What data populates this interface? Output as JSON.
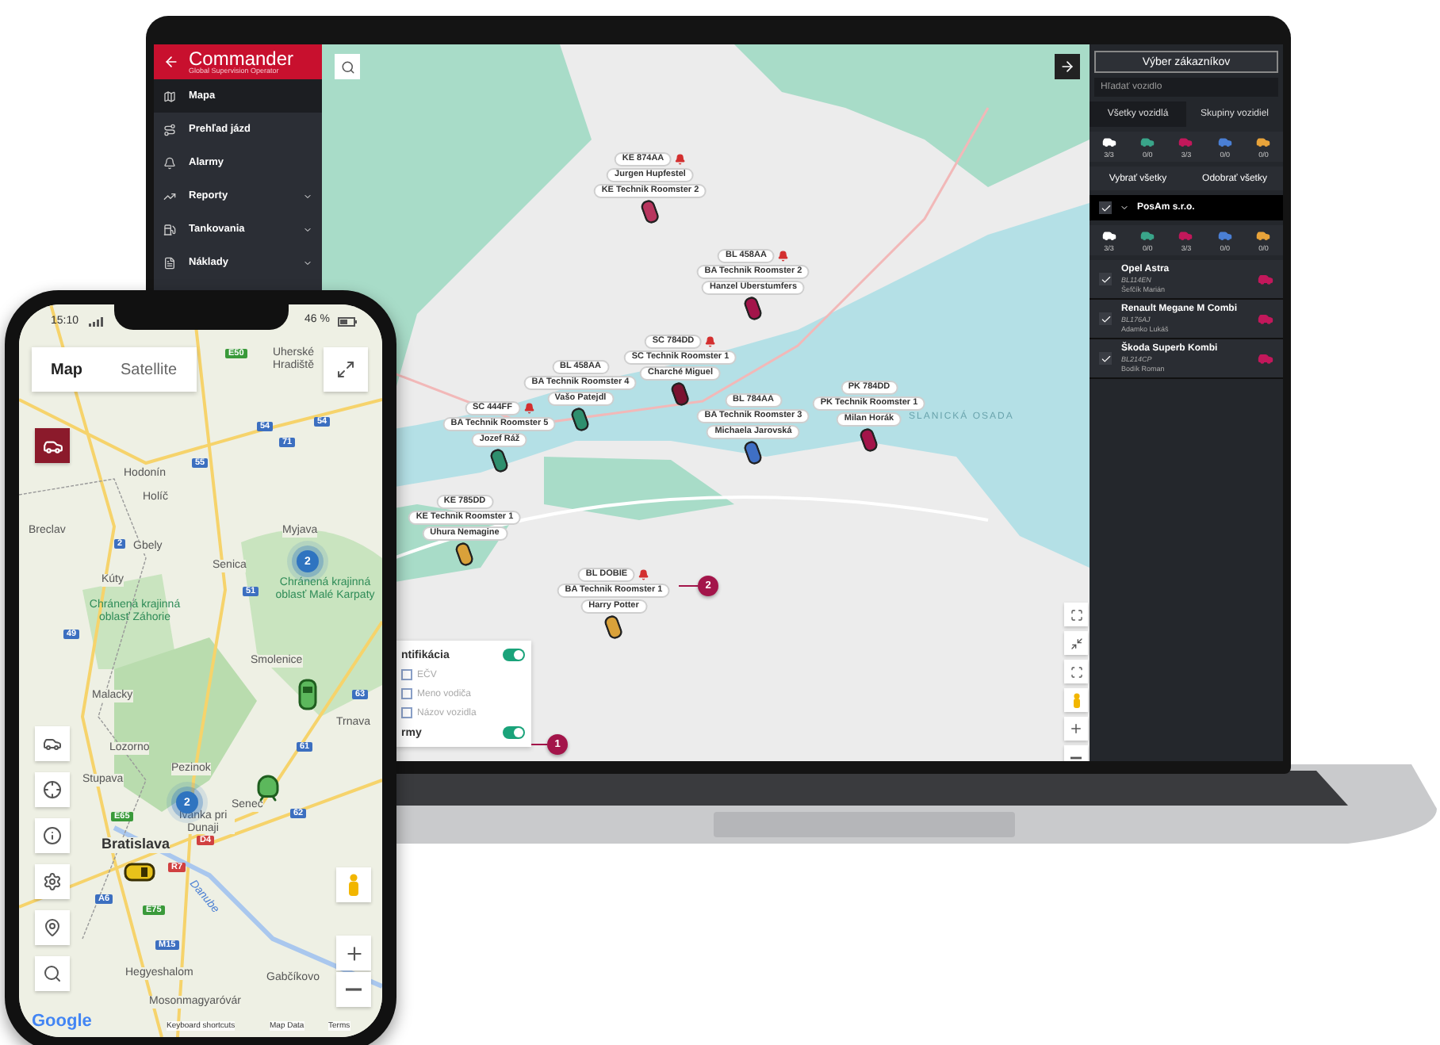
{
  "laptop": {
    "sidebar": {
      "logo": "Commander",
      "tagline": "Global Supervision Operator",
      "items": [
        {
          "label": "Mapa",
          "selected": true,
          "expandable": false
        },
        {
          "label": "Prehľad jázd",
          "selected": false,
          "expandable": false
        },
        {
          "label": "Alarmy",
          "selected": false,
          "expandable": false
        },
        {
          "label": "Reporty",
          "selected": false,
          "expandable": true
        },
        {
          "label": "Tankovania",
          "selected": false,
          "expandable": true
        },
        {
          "label": "Náklady",
          "selected": false,
          "expandable": true
        }
      ]
    },
    "map": {
      "markers": [
        {
          "plate": "KE 874AA",
          "driver": "Jurgen Hupfestel",
          "vehicle": "KE Technik Roomster 2",
          "alarm": true,
          "color": "#b8355e"
        },
        {
          "plate": "BL 458AA",
          "driver": "BA Technik Roomster 2",
          "vehicle": "Hanzel Uberstumfers",
          "alarm": true,
          "color": "#a3154a"
        },
        {
          "plate": "SC 784DD",
          "driver": "SC Technik Roomster 1",
          "vehicle": "Charché Miguel",
          "alarm": true,
          "color": "#7a1230"
        },
        {
          "plate": "BL 458AA",
          "driver": "BA Technik Roomster 4",
          "vehicle": "Vašo Patejdl",
          "alarm": false,
          "color": "#2f8f6e"
        },
        {
          "plate": "SC 444FF",
          "driver": "BA Technik Roomster 5",
          "vehicle": "Jozef Ráž",
          "alarm": true,
          "color": "#2f8f6e"
        },
        {
          "plate": "BL 784AA",
          "driver": "BA Technik Roomster 3",
          "vehicle": "Michaela Jarovská",
          "alarm": false,
          "color": "#3f6fc4"
        },
        {
          "plate": "PK 784DD",
          "driver": "PK Technik Roomster 1",
          "vehicle": "Milan Horák",
          "alarm": false,
          "color": "#a3154a"
        },
        {
          "plate": "KE 785DD",
          "driver": "KE Technik Roomster 1",
          "vehicle": "Uhura Nemagine",
          "alarm": false,
          "color": "#d9a13a"
        },
        {
          "plate": "BL DOBIE",
          "driver": "BA Technik Roomster 1",
          "vehicle": "Harry Potter",
          "alarm": true,
          "color": "#d9a13a"
        }
      ],
      "marker_callout": "2",
      "place_label": "SLANICKÁ OSADA",
      "legend": {
        "title": "ntifikácia",
        "on": true,
        "options": [
          {
            "label": "EČV",
            "checked": false
          },
          {
            "label": "Meno vodiča",
            "checked": false
          },
          {
            "label": "Názov vozidla",
            "checked": false
          }
        ],
        "alarms": {
          "label": "rmy",
          "on": true,
          "callout": "1"
        }
      }
    },
    "panel": {
      "customer_button": "Výber zákazníkov",
      "search": {
        "placeholder": "Hľadať vozidlo"
      },
      "tabs": [
        {
          "label": "Všetky vozidlá",
          "selected": true
        },
        {
          "label": "Skupiny vozidiel",
          "selected": false
        }
      ],
      "counts": [
        {
          "color": "#ffffff",
          "count": "3/3"
        },
        {
          "color": "#3aa58a",
          "count": "0/0"
        },
        {
          "color": "#c2185b",
          "count": "3/3"
        },
        {
          "color": "#4a7fd4",
          "count": "0/0"
        },
        {
          "color": "#e8a33a",
          "count": "0/0"
        }
      ],
      "select_all": "Vybrať všetky",
      "deselect_all": "Odobrať všetky",
      "group": {
        "name": "PosAm s.r.o.",
        "checked": true,
        "expanded": true,
        "counts": [
          {
            "color": "#ffffff",
            "count": "3/3"
          },
          {
            "color": "#3aa58a",
            "count": "0/0"
          },
          {
            "color": "#c2185b",
            "count": "3/3"
          },
          {
            "color": "#4a7fd4",
            "count": "0/0"
          },
          {
            "color": "#e8a33a",
            "count": "0/0"
          }
        ]
      },
      "vehicles": [
        {
          "name": "Opel Astra",
          "plate": "BL114EN",
          "driver": "Šefčík Marián",
          "checked": true,
          "color": "#c2185b"
        },
        {
          "name": "Renault Megane M Combi",
          "plate": "BL176AJ",
          "driver": "Adamko Lukáš",
          "checked": true,
          "color": "#c2185b"
        },
        {
          "name": "Škoda Superb Kombi",
          "plate": "BL214CP",
          "driver": "Bodík Roman",
          "checked": true,
          "color": "#c2185b"
        }
      ]
    }
  },
  "phone": {
    "time": "15:10",
    "battery": "46 %",
    "tabs": [
      {
        "label": "Map",
        "selected": true
      },
      {
        "label": "Satellite",
        "selected": false
      }
    ],
    "vehicle_filter": {
      "selected": true
    },
    "places": [
      {
        "text": "E50",
        "kind": "euroroute"
      },
      {
        "text": "Uherské Hradiště",
        "kind": "town"
      },
      {
        "text": "54",
        "kind": "motorway"
      },
      {
        "text": "54",
        "kind": "motorway"
      },
      {
        "text": "71",
        "kind": "motorway"
      },
      {
        "text": "55",
        "kind": "motorway"
      },
      {
        "text": "Hodonín",
        "kind": "town"
      },
      {
        "text": "Holíč",
        "kind": "town"
      },
      {
        "text": "Breclav",
        "kind": "town"
      },
      {
        "text": "2",
        "kind": "motorway"
      },
      {
        "text": "Gbely",
        "kind": "town"
      },
      {
        "text": "Kúty",
        "kind": "town"
      },
      {
        "text": "Senica",
        "kind": "town"
      },
      {
        "text": "51",
        "kind": "motorway"
      },
      {
        "text": "Myjava",
        "kind": "town"
      },
      {
        "text": "Chránená krajinná oblasť Malé Karpaty",
        "kind": "park"
      },
      {
        "text": "Chránená krajinná oblasť Záhorie",
        "kind": "park"
      },
      {
        "text": "49",
        "kind": "motorway"
      },
      {
        "text": "Smolenice",
        "kind": "town"
      },
      {
        "text": "Malacky",
        "kind": "town"
      },
      {
        "text": "Lozorno",
        "kind": "town"
      },
      {
        "text": "Stupava",
        "kind": "town"
      },
      {
        "text": "Pezinok",
        "kind": "town"
      },
      {
        "text": "E65",
        "kind": "euroroute"
      },
      {
        "text": "Ivanka pri Dunaji",
        "kind": "town"
      },
      {
        "text": "D4",
        "kind": "expressway"
      },
      {
        "text": "Bratislava",
        "kind": "city"
      },
      {
        "text": "Senec",
        "kind": "town"
      },
      {
        "text": "62",
        "kind": "motorway"
      },
      {
        "text": "61",
        "kind": "motorway"
      },
      {
        "text": "63",
        "kind": "motorway"
      },
      {
        "text": "Trnava",
        "kind": "town"
      },
      {
        "text": "R7",
        "kind": "expressway"
      },
      {
        "text": "A6",
        "kind": "motorway"
      },
      {
        "text": "E75",
        "kind": "euroroute"
      },
      {
        "text": "Danube",
        "kind": "river"
      },
      {
        "text": "M15",
        "kind": "motorway"
      },
      {
        "text": "Hegyeshalom",
        "kind": "town"
      },
      {
        "text": "Gabčíkovo",
        "kind": "town"
      },
      {
        "text": "Mosonmagyaróvár",
        "kind": "town"
      }
    ],
    "clusters": [
      "2",
      "2"
    ],
    "logo": "Google",
    "footer": [
      "Keyboard shortcuts",
      "Map Data",
      "Terms"
    ]
  }
}
